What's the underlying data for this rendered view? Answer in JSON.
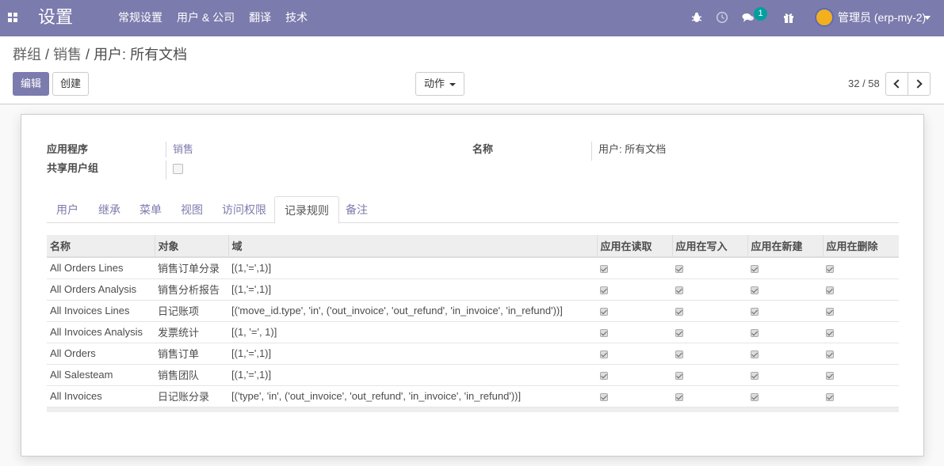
{
  "navbar": {
    "brand": "设置",
    "menu": [
      "常规设置",
      "用户 & 公司",
      "翻译",
      "技术"
    ],
    "chat_badge": "1",
    "user": "管理员 (erp-my-2)"
  },
  "control_panel": {
    "breadcrumb": [
      "群组",
      "销售",
      "用户: 所有文档"
    ],
    "edit_label": "编辑",
    "create_label": "创建",
    "action_label": "动作",
    "pager": "32 / 58"
  },
  "form": {
    "app_label": "应用程序",
    "app_value": "销售",
    "shared_label": "共享用户组",
    "name_label": "名称",
    "name_value": "用户: 所有文档"
  },
  "tabs": [
    "用户",
    "继承",
    "菜单",
    "视图",
    "访问权限",
    "记录规则",
    "备注"
  ],
  "active_tab": "记录规则",
  "table": {
    "columns": [
      "名称",
      "对象",
      "域",
      "应用在读取",
      "应用在写入",
      "应用在新建",
      "应用在删除"
    ],
    "rows": [
      {
        "name": "All Orders Lines",
        "object": "销售订单分录",
        "domain": "[(1,'=',1)]"
      },
      {
        "name": "All Orders Analysis",
        "object": "销售分析报告",
        "domain": "[(1,'=',1)]"
      },
      {
        "name": "All Invoices Lines",
        "object": "日记账项",
        "domain": "[('move_id.type', 'in', ('out_invoice', 'out_refund', 'in_invoice', 'in_refund'))]"
      },
      {
        "name": "All Invoices Analysis",
        "object": "发票统计",
        "domain": "[(1, '=', 1)]"
      },
      {
        "name": "All Orders",
        "object": "销售订单",
        "domain": "[(1,'=',1)]"
      },
      {
        "name": "All Salesteam",
        "object": "销售团队",
        "domain": "[(1,'=',1)]"
      },
      {
        "name": "All Invoices",
        "object": "日记账分录",
        "domain": "[('type', 'in', ('out_invoice', 'out_refund', 'in_invoice', 'in_refund'))]"
      }
    ]
  },
  "colors": {
    "brand": "#7c7bad",
    "badge": "#00a09d"
  }
}
